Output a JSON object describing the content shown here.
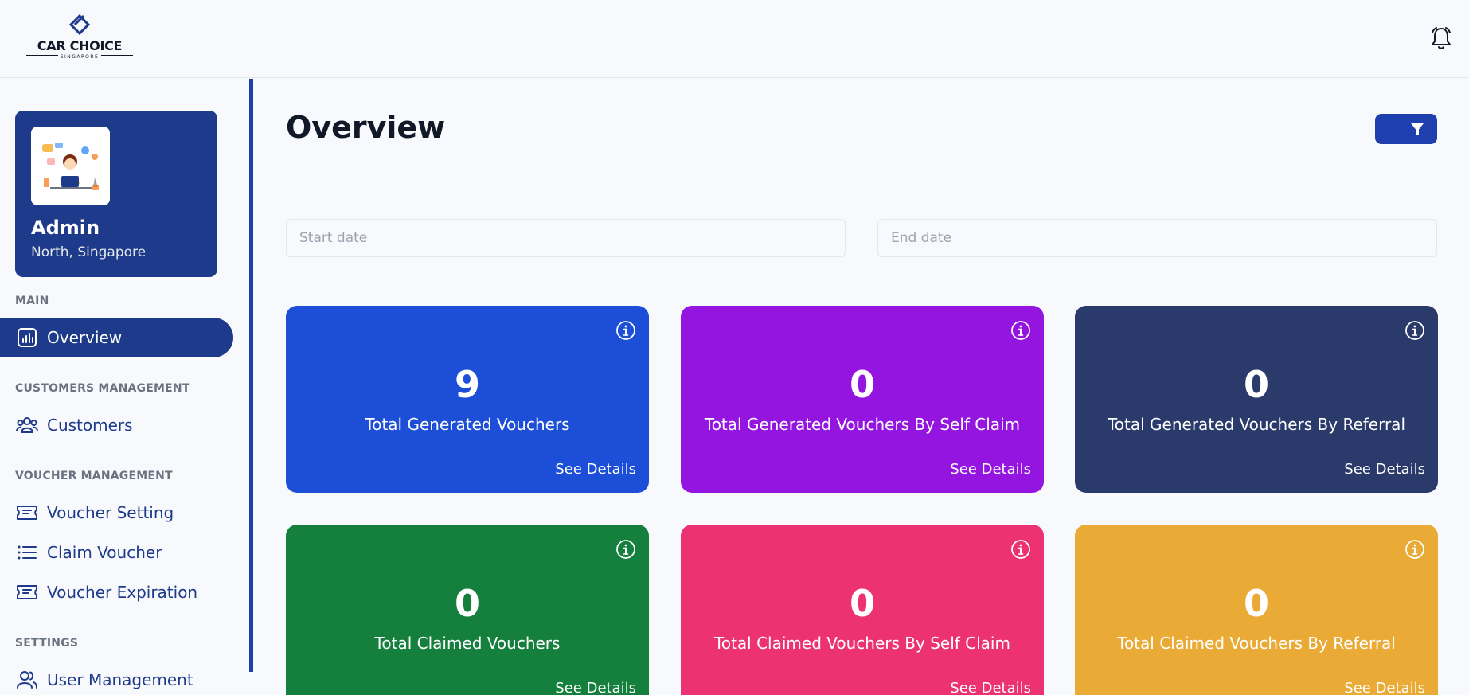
{
  "brand": {
    "name": "CAR CHOICE",
    "tagline": "SINGAPORE"
  },
  "header": {
    "notification_icon": "bell-icon"
  },
  "profile": {
    "name": "Admin",
    "location": "North, Singapore"
  },
  "sidebar": {
    "sections": {
      "main": "MAIN",
      "customers": "CUSTOMERS MANAGEMENT",
      "vouchers": "VOUCHER MANAGEMENT",
      "settings": "SETTINGS"
    },
    "items": {
      "overview": {
        "label": "Overview",
        "icon": "bar-chart-icon"
      },
      "customers": {
        "label": "Customers",
        "icon": "users-icon"
      },
      "voucher_setting": {
        "label": "Voucher Setting",
        "icon": "ticket-icon"
      },
      "claim_voucher": {
        "label": "Claim Voucher",
        "icon": "list-icon"
      },
      "voucher_expiration": {
        "label": "Voucher Expiration",
        "icon": "ticket-icon"
      },
      "user_management": {
        "label": "User Management",
        "icon": "users-icon"
      }
    }
  },
  "main": {
    "title": "Overview",
    "filter_icon": "filter-icon",
    "start_date": {
      "value": "",
      "placeholder": "Start date"
    },
    "end_date": {
      "value": "",
      "placeholder": "End date"
    },
    "cards": [
      {
        "value": "9",
        "label": "Total Generated Vouchers",
        "link": "See Details",
        "color": "#1d4ed8"
      },
      {
        "value": "0",
        "label": "Total Generated Vouchers By Self Claim",
        "link": "See Details",
        "color": "#9414e0"
      },
      {
        "value": "0",
        "label": "Total Generated Vouchers By Referral",
        "link": "See Details",
        "color": "#2a3a6a"
      },
      {
        "value": "0",
        "label": "Total Claimed Vouchers",
        "link": "See Details",
        "color": "#15803d"
      },
      {
        "value": "0",
        "label": "Total Claimed Vouchers By Self Claim",
        "link": "See Details",
        "color": "#ec3270"
      },
      {
        "value": "0",
        "label": "Total Claimed Vouchers By Referral",
        "link": "See Details",
        "color": "#eaaa36"
      }
    ]
  }
}
